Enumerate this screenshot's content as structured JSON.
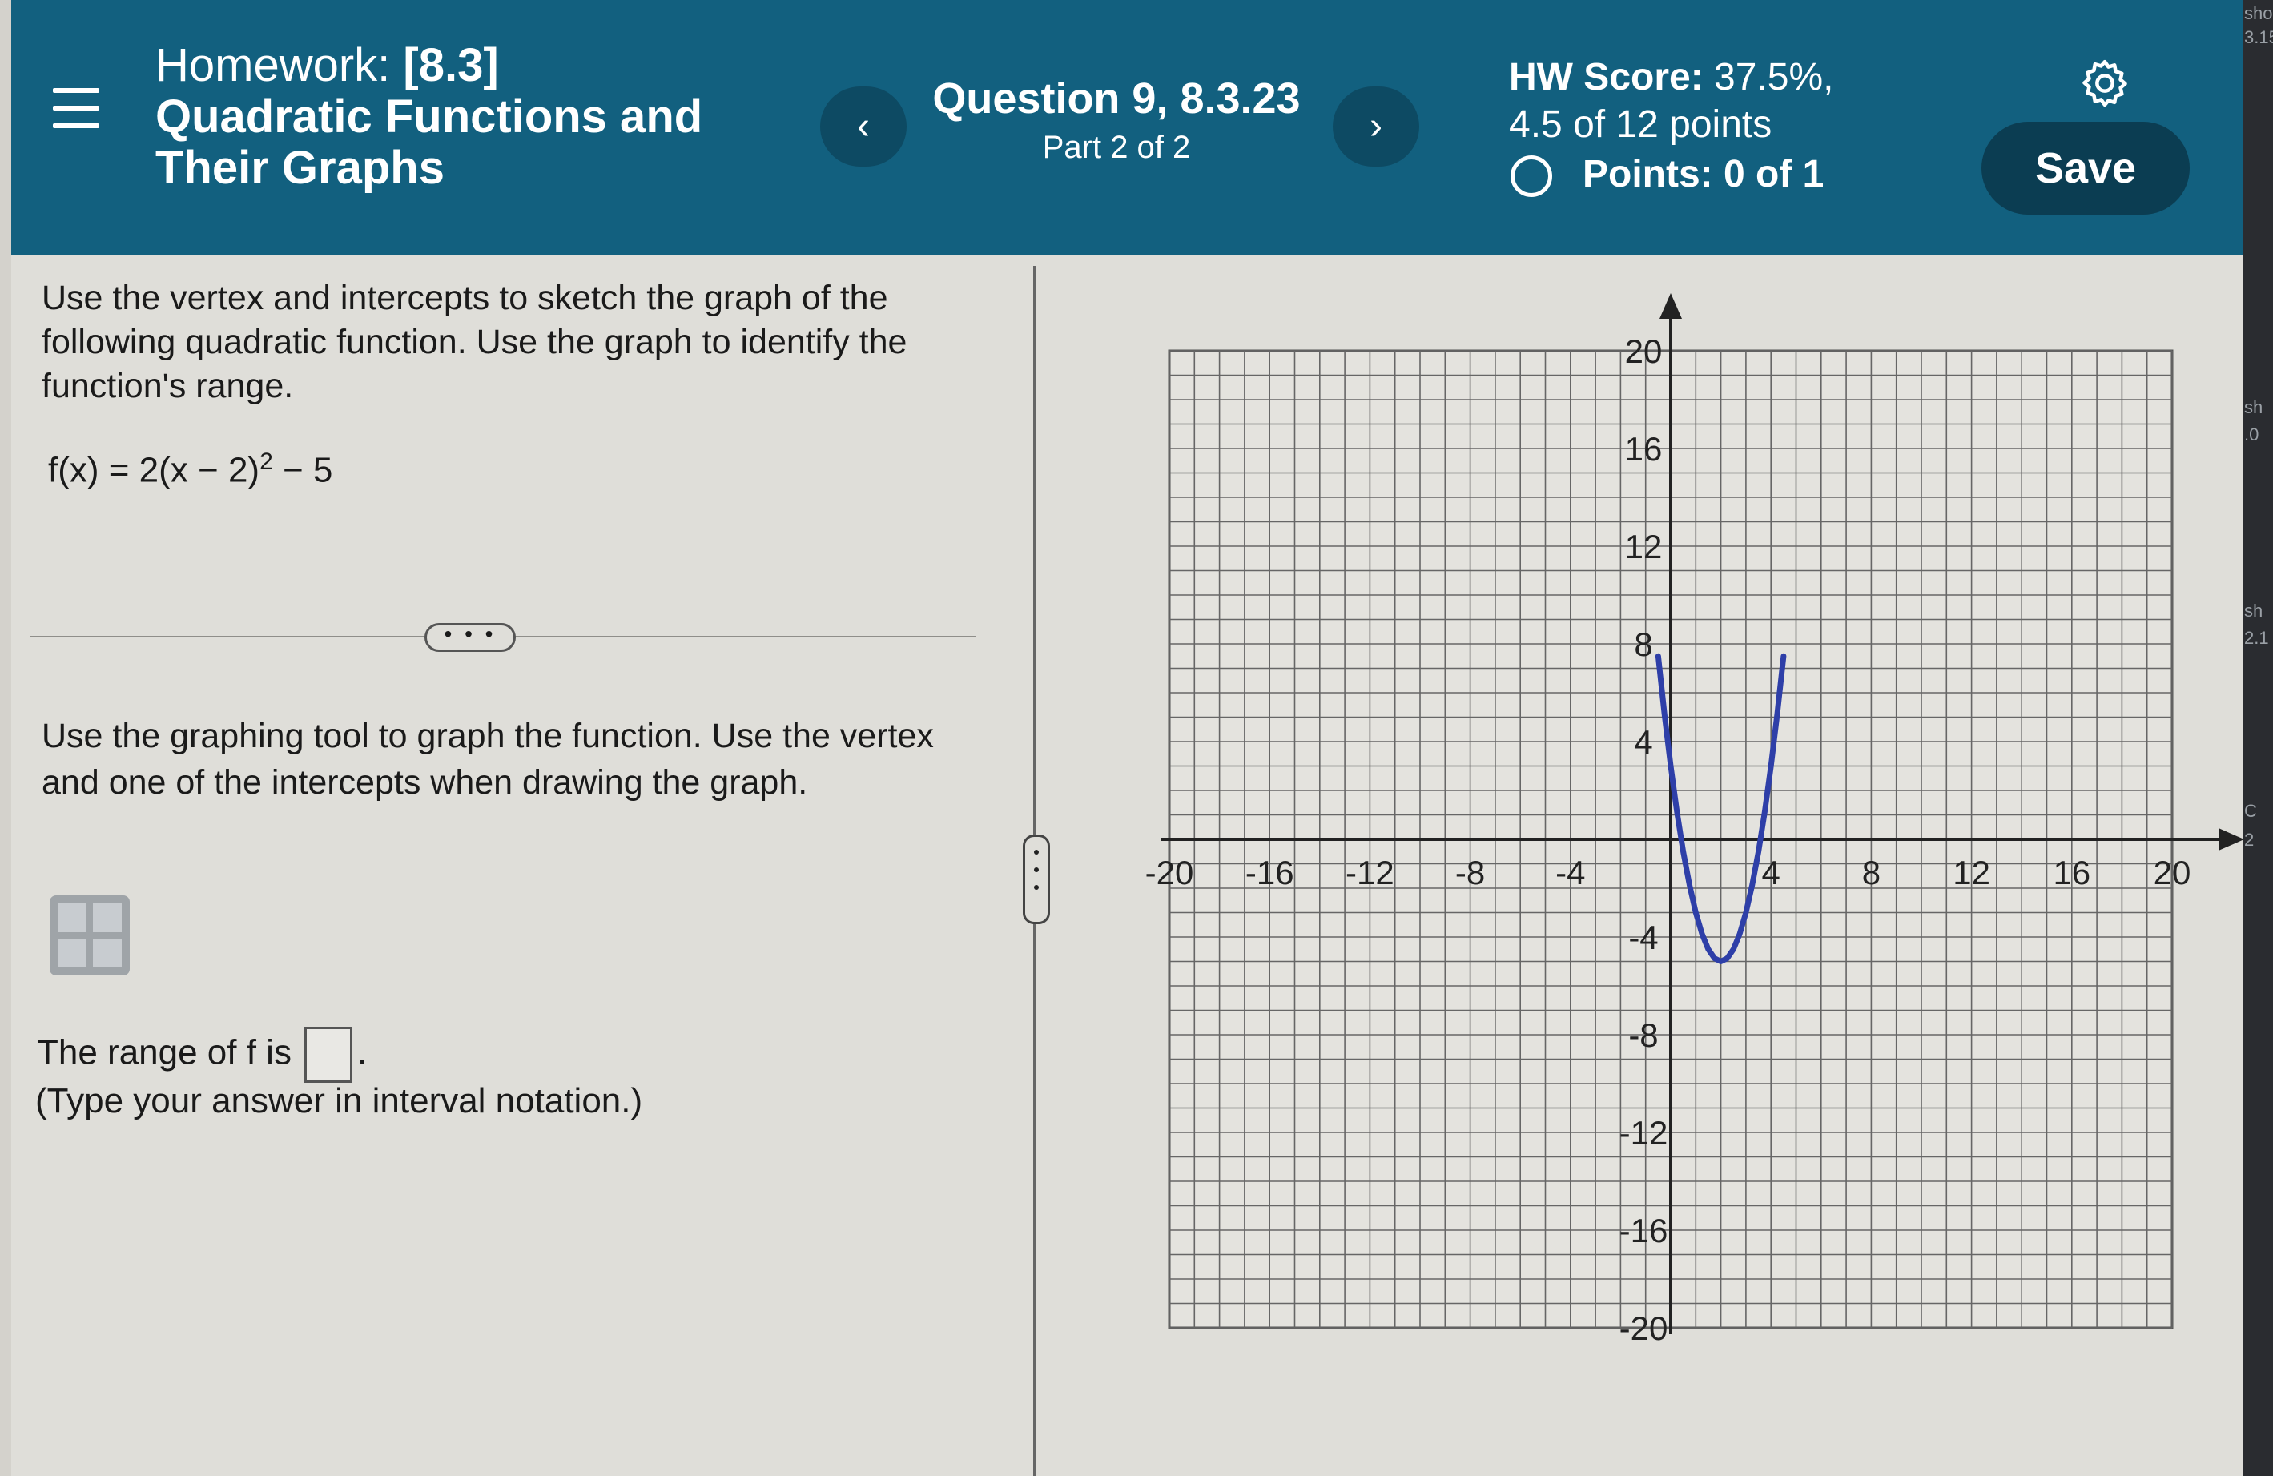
{
  "header": {
    "homework_label": "Homework:",
    "section": "[8.3]",
    "title": "Quadratic Functions and Their Graphs",
    "question": "Question 9, 8.3.23",
    "part": "Part 2 of 2",
    "hw_score_label": "HW Score:",
    "hw_score_value": "37.5%,",
    "hw_points": "4.5 of 12 points",
    "points": "Points: 0 of 1",
    "save_label": "Save",
    "prev_icon": "chevron-left-icon",
    "next_icon": "chevron-right-icon",
    "settings_icon": "gear-icon",
    "menu_icon": "hamburger-menu-icon"
  },
  "question": {
    "prompt": "Use the vertex and intercepts to sketch the graph of the following quadratic function. Use the graph to identify the function's range.",
    "function_lhs": "f(x) = 2(x − 2)",
    "function_exponent": "2",
    "function_rhs": " − 5",
    "more_label": "• • •",
    "instruction": "Use the graphing tool to graph the function. Use the vertex and one of the intercepts when drawing the graph.",
    "range_prefix": "The range of f is",
    "range_value": "",
    "range_suffix": ".",
    "hint": "(Type your answer in interval notation.)"
  },
  "edge": {
    "labels": [
      "sho",
      "3.15",
      "sh",
      ".0",
      "sh",
      "2.1",
      "C",
      "2"
    ]
  },
  "chart_data": {
    "type": "line",
    "xlim": [
      -20,
      20
    ],
    "ylim": [
      -20,
      20
    ],
    "grid": true,
    "x_ticks": [
      -20,
      -16,
      -12,
      -8,
      -4,
      4,
      8,
      12,
      16,
      20
    ],
    "y_ticks": [
      20,
      16,
      12,
      8,
      4,
      -4,
      -8,
      -12,
      -16,
      -20
    ],
    "function": "2(x-2)^2-5",
    "vertex": [
      2,
      -5
    ],
    "series": [
      {
        "color": "#2e3fa8",
        "x": [
          -0.5,
          -0.25,
          0,
          0.25,
          0.5,
          0.75,
          1,
          1.25,
          1.5,
          1.75,
          2,
          2.25,
          2.5,
          2.75,
          3,
          3.25,
          3.5,
          3.75,
          4,
          4.25,
          4.5
        ],
        "y": [
          7.5,
          5.125,
          3,
          1.125,
          -0.5,
          -1.875,
          -3,
          -3.875,
          -4.5,
          -4.875,
          -5,
          -4.875,
          -4.5,
          -3.875,
          -3,
          -1.875,
          -0.5,
          1.125,
          3,
          5.125,
          7.5
        ]
      }
    ]
  }
}
